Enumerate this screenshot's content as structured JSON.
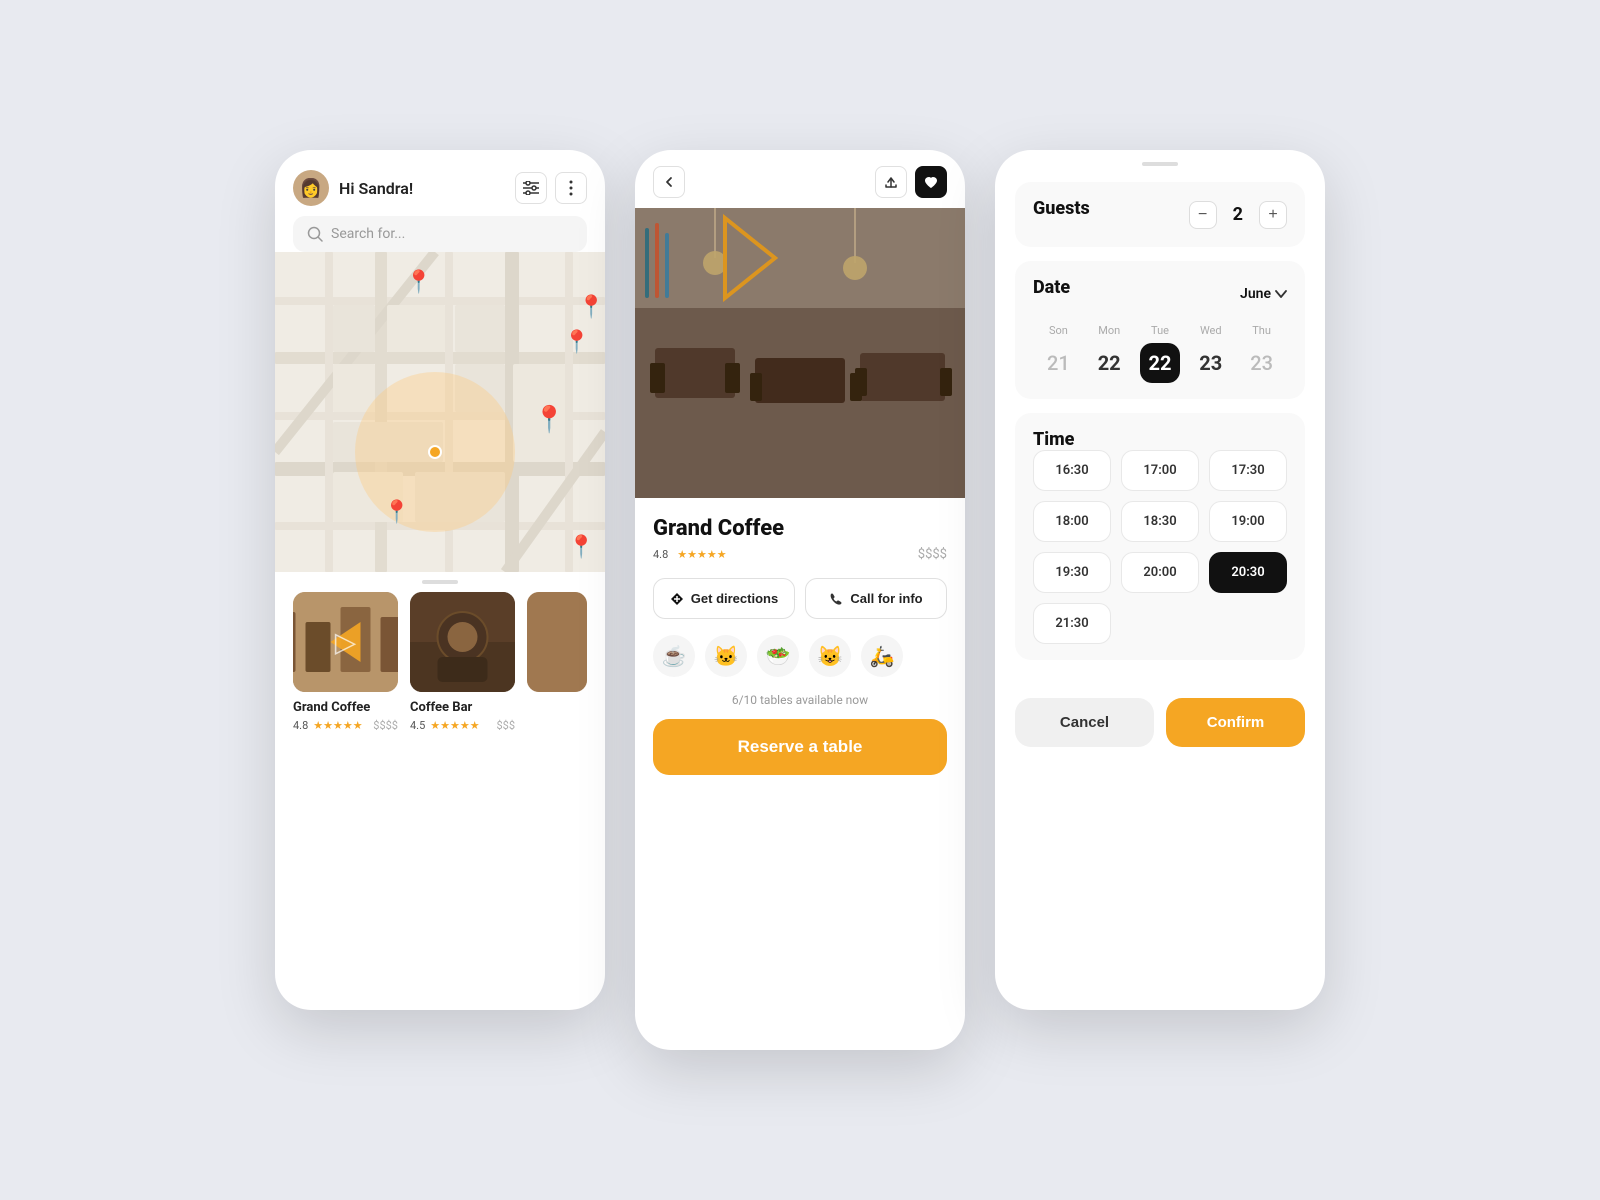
{
  "screen1": {
    "greeting": "Hi Sandra!",
    "search_placeholder": "Search for...",
    "filter_icon": "⚙",
    "more_icon": "⋯",
    "card1": {
      "name": "Grand Coffee",
      "rating": "4.8",
      "price": "$$$$"
    },
    "card2": {
      "name": "Coffee Bar",
      "rating": "4.5",
      "price": "$$$"
    }
  },
  "screen2": {
    "restaurant_name": "Grand Coffee",
    "rating": "4.8",
    "price": "$$$$",
    "get_directions_label": "Get directions",
    "call_for_info_label": "Call for info",
    "emojis": [
      "☕",
      "🐱",
      "🥗",
      "😺",
      "🛵"
    ],
    "tables_info": "6/10 tables available now",
    "reserve_btn_label": "Reserve a table"
  },
  "screen3": {
    "guests_label": "Guests",
    "guests_count": "2",
    "date_label": "Date",
    "month": "June",
    "days": [
      {
        "name": "Son",
        "num": "21",
        "style": "light"
      },
      {
        "name": "Mon",
        "num": "22",
        "style": "normal"
      },
      {
        "name": "Tue",
        "num": "22",
        "style": "selected"
      },
      {
        "name": "Wed",
        "num": "23",
        "style": "normal"
      },
      {
        "name": "Thu",
        "num": "23",
        "style": "light"
      }
    ],
    "time_label": "Time",
    "times": [
      {
        "label": "16:30",
        "selected": false
      },
      {
        "label": "17:00",
        "selected": false
      },
      {
        "label": "17:30",
        "selected": false
      },
      {
        "label": "18:00",
        "selected": false
      },
      {
        "label": "18:30",
        "selected": false
      },
      {
        "label": "19:00",
        "selected": false
      },
      {
        "label": "19:30",
        "selected": false
      },
      {
        "label": "20:00",
        "selected": false
      },
      {
        "label": "20:30",
        "selected": true
      },
      {
        "label": "21:30",
        "selected": false
      }
    ],
    "cancel_label": "Cancel",
    "confirm_label": "Confirm"
  },
  "stars": "★★★★★"
}
